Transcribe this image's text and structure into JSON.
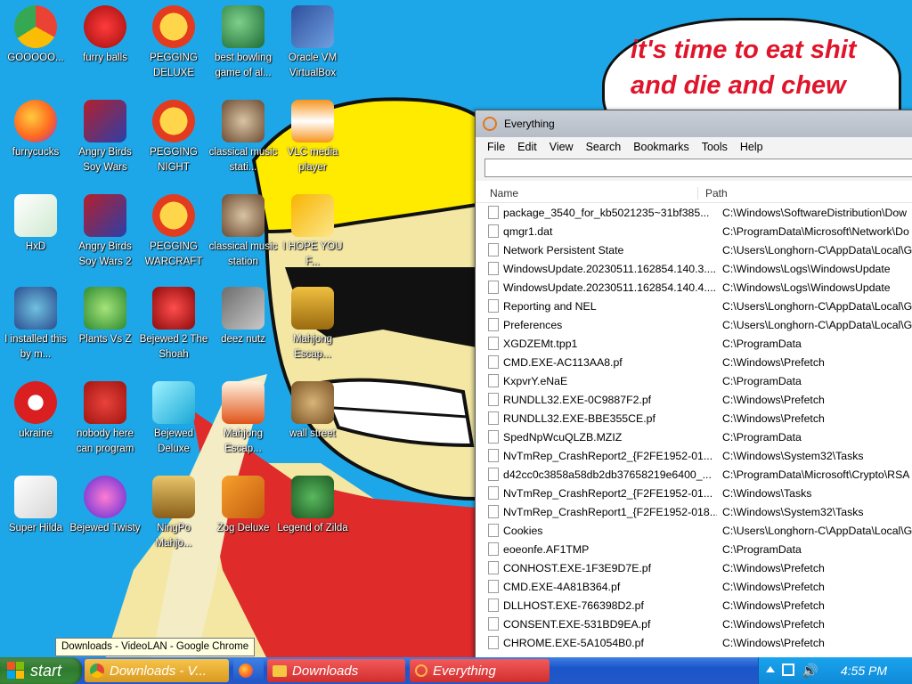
{
  "wallpaper": {
    "speech_bubble": "it's time to eat shit and die and chew"
  },
  "desktop_icons": [
    {
      "label": "GOOOOO...",
      "icon": "chrome-icon"
    },
    {
      "label": "furry balls",
      "icon": "red-ball-icon"
    },
    {
      "label": "PEGGING DELUXE",
      "icon": "pegging-p-icon"
    },
    {
      "label": "best bowling game of al...",
      "icon": "bowling-icon"
    },
    {
      "label": "Oracle VM VirtualBox",
      "icon": "virtualbox-icon"
    },
    {
      "label": "furrycucks",
      "icon": "firefox-icon"
    },
    {
      "label": "Angry Birds Soy Wars",
      "icon": "angry-birds-icon"
    },
    {
      "label": "PEGGING NIGHT",
      "icon": "pegging-p-icon"
    },
    {
      "label": "classical music stati...",
      "icon": "portrait-icon"
    },
    {
      "label": "VLC media player",
      "icon": "vlc-cone-icon"
    },
    {
      "label": "HxD",
      "icon": "hxd-icon"
    },
    {
      "label": "Angry Birds Soy Wars 2",
      "icon": "angry-birds-icon"
    },
    {
      "label": "PEGGING WARCRAFT",
      "icon": "pegging-p-icon"
    },
    {
      "label": "classical music station",
      "icon": "portrait-icon"
    },
    {
      "label": "I HOPE YOU F...",
      "icon": "de-icon"
    },
    {
      "label": "I installed this by m...",
      "icon": "character-icon"
    },
    {
      "label": "Plants Vs Z",
      "icon": "plant-icon"
    },
    {
      "label": "Bejewed 2 The Shoah",
      "icon": "bejeweled-2-icon"
    },
    {
      "label": "deez nutz",
      "icon": "windows-stack-icon"
    },
    {
      "label": "Mahjong Escap...",
      "icon": "mahjong-icon"
    },
    {
      "label": "ukraine",
      "icon": "radiation-icon"
    },
    {
      "label": "nobody here can program",
      "icon": "devcpp-icon"
    },
    {
      "label": "Bejewed Deluxe",
      "icon": "diamond-icon"
    },
    {
      "label": "Mahjong Escap...",
      "icon": "torii-icon"
    },
    {
      "label": "wall street",
      "icon": "money-bag-icon"
    },
    {
      "label": "Super Hilda",
      "icon": "pixel-dog-icon"
    },
    {
      "label": "Bejewed Twisty",
      "icon": "twist-gem-icon"
    },
    {
      "label": "NingPo Mahjo...",
      "icon": "ningpo-icon"
    },
    {
      "label": "Zog Deluxe",
      "icon": "zog-icon"
    },
    {
      "label": "Legend of Zilda",
      "icon": "link-icon"
    }
  ],
  "everything_window": {
    "title": "Everything",
    "menu": [
      "File",
      "Edit",
      "View",
      "Search",
      "Bookmarks",
      "Tools",
      "Help"
    ],
    "search_value": "",
    "columns": {
      "name": "Name",
      "path": "Path"
    },
    "rows": [
      {
        "name": "package_3540_for_kb5021235~31bf385...",
        "path": "C:\\Windows\\SoftwareDistribution\\Dow"
      },
      {
        "name": "qmgr1.dat",
        "path": "C:\\ProgramData\\Microsoft\\Network\\Do"
      },
      {
        "name": "Network Persistent State",
        "path": "C:\\Users\\Longhorn-C\\AppData\\Local\\Go"
      },
      {
        "name": "WindowsUpdate.20230511.162854.140.3....",
        "path": "C:\\Windows\\Logs\\WindowsUpdate"
      },
      {
        "name": "WindowsUpdate.20230511.162854.140.4....",
        "path": "C:\\Windows\\Logs\\WindowsUpdate"
      },
      {
        "name": "Reporting and NEL",
        "path": "C:\\Users\\Longhorn-C\\AppData\\Local\\Go"
      },
      {
        "name": "Preferences",
        "path": "C:\\Users\\Longhorn-C\\AppData\\Local\\Go"
      },
      {
        "name": "XGDZEMt.tpp1",
        "path": "C:\\ProgramData"
      },
      {
        "name": "CMD.EXE-AC113AA8.pf",
        "path": "C:\\Windows\\Prefetch"
      },
      {
        "name": "KxpvrY.eNaE",
        "path": "C:\\ProgramData"
      },
      {
        "name": "RUNDLL32.EXE-0C9887F2.pf",
        "path": "C:\\Windows\\Prefetch"
      },
      {
        "name": "RUNDLL32.EXE-BBE355CE.pf",
        "path": "C:\\Windows\\Prefetch"
      },
      {
        "name": "SpedNpWcuQLZB.MZIZ",
        "path": "C:\\ProgramData"
      },
      {
        "name": "NvTmRep_CrashReport2_{F2FE1952-01...",
        "path": "C:\\Windows\\System32\\Tasks"
      },
      {
        "name": "d42cc0c3858a58db2db37658219e6400_...",
        "path": "C:\\ProgramData\\Microsoft\\Crypto\\RSA"
      },
      {
        "name": "NvTmRep_CrashReport2_{F2FE1952-01...",
        "path": "C:\\Windows\\Tasks"
      },
      {
        "name": "NvTmRep_CrashReport1_{F2FE1952-018...",
        "path": "C:\\Windows\\System32\\Tasks"
      },
      {
        "name": "Cookies",
        "path": "C:\\Users\\Longhorn-C\\AppData\\Local\\Go"
      },
      {
        "name": "eoeonfe.AF1TMP",
        "path": "C:\\ProgramData"
      },
      {
        "name": "CONHOST.EXE-1F3E9D7E.pf",
        "path": "C:\\Windows\\Prefetch"
      },
      {
        "name": "CMD.EXE-4A81B364.pf",
        "path": "C:\\Windows\\Prefetch"
      },
      {
        "name": "DLLHOST.EXE-766398D2.pf",
        "path": "C:\\Windows\\Prefetch"
      },
      {
        "name": "CONSENT.EXE-531BD9EA.pf",
        "path": "C:\\Windows\\Prefetch"
      },
      {
        "name": "CHROME.EXE-5A1054B0.pf",
        "path": "C:\\Windows\\Prefetch"
      }
    ]
  },
  "tooltip": "Downloads - VideoLAN - Google Chrome",
  "taskbar": {
    "start_label": "start",
    "tasks": [
      {
        "label": "Downloads - V...",
        "icon": "chrome-icon"
      },
      {
        "label": "",
        "icon": "firefox-icon"
      },
      {
        "label": "Downloads",
        "icon": "folder-icon"
      },
      {
        "label": "Everything",
        "icon": "everything-search-icon"
      }
    ],
    "clock": "4:55 PM"
  },
  "colors": {
    "desktop_bg": "#1ea7e8",
    "bubble_text": "#e0142a",
    "taskbar_blue": "#2458c8",
    "start_green": "#3b8c38"
  }
}
